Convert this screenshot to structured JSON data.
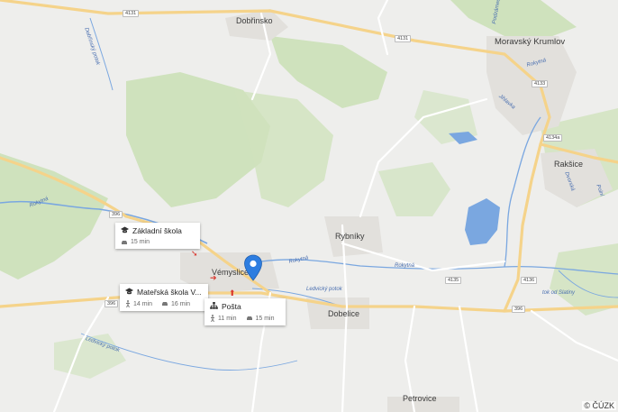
{
  "towns": {
    "dobrinsko": "Dobřinsko",
    "moravsky_krumlov": "Moravský Krumlov",
    "raksice": "Rakšice",
    "rybniky": "Rybníky",
    "vemyslice": "Vémyslice",
    "dobelice": "Dobelice",
    "petrovice": "Petrovice"
  },
  "rivers": {
    "dobrinsky_potok": "Dobřínský potok",
    "rokytna_west": "Rokytná",
    "rokytna_mid": "Rokytná",
    "rokytna_east": "Rokytná",
    "ledvicky_potok_1": "Ledvický potok",
    "ledvicky_potok_2": "Ledvický potok",
    "podzamecky": "Podzámecký",
    "rokytna_k": "Rokytná",
    "jihlavka": "Jihlavka",
    "polni": "Polní",
    "dvorska": "Dvorská",
    "tok_od_slatiny": "tok od Slatiny"
  },
  "road_numbers": {
    "r4131_a": "4131",
    "r4131_b": "4131",
    "r396_a": "396",
    "r396_b": "396",
    "r396_c": "396",
    "r4133": "4133",
    "r4134": "4134a",
    "r4135": "4135",
    "r4136": "4136"
  },
  "cards": [
    {
      "icon": "school-icon",
      "title": "Základní škola",
      "car_time": "15 min"
    },
    {
      "icon": "school-icon",
      "title": "Mateřská škola V...",
      "walk_time": "14 min",
      "car_time": "16 min"
    },
    {
      "icon": "post-office-icon",
      "title": "Pošta",
      "walk_time": "11 min",
      "car_time": "15 min"
    }
  ],
  "colors": {
    "background": "#eeeeec",
    "forest": "#cfe2bd",
    "water": "#7aa7e0",
    "road_major": "#f5d38a",
    "road_minor": "#ffffff",
    "pin": "#2d7de0"
  },
  "copyright": "© ČÚZK"
}
